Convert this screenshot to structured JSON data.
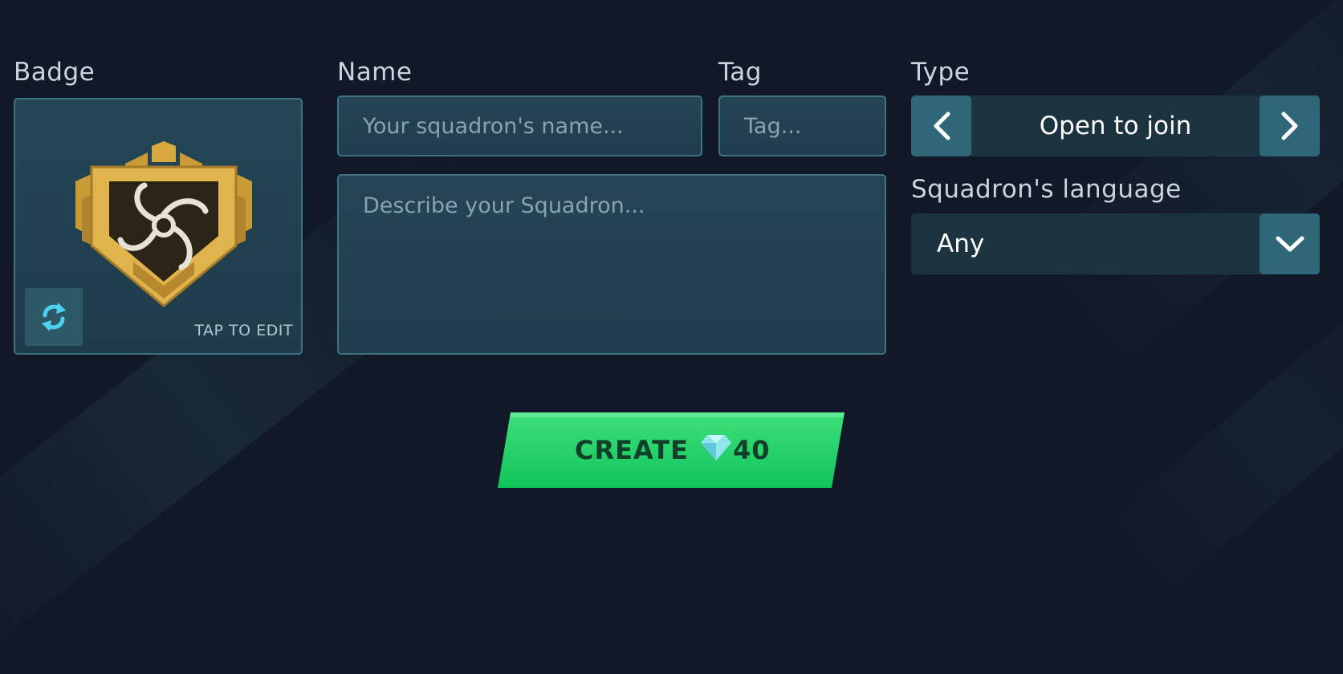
{
  "badge": {
    "label": "Badge",
    "edit_hint": "TAP TO EDIT"
  },
  "name": {
    "label": "Name",
    "placeholder": "Your squadron's name..."
  },
  "tag": {
    "label": "Tag",
    "placeholder": "Tag..."
  },
  "description": {
    "placeholder": "Describe your Squadron..."
  },
  "type": {
    "label": "Type",
    "value": "Open to join"
  },
  "language": {
    "label": "Squadron's language",
    "value": "Any"
  },
  "create": {
    "label": "CREATE",
    "cost": "40"
  },
  "colors": {
    "background": "#111827",
    "panel": "#224252",
    "panel_border": "#3f7384",
    "accent_button": "#2f6678",
    "create_green": "#1ed46a",
    "badge_gold": "#e0b44c"
  }
}
